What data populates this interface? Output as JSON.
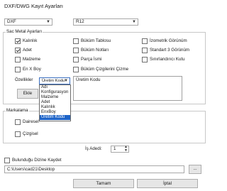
{
  "window": {
    "title": "DXF/DWG Kayıt Ayarları"
  },
  "top": {
    "format_value": "DXF",
    "version_value": "R12"
  },
  "sheet_metal": {
    "group_title": "Sac Metal Ayarları",
    "col1": [
      {
        "label": "Kalınlık",
        "checked": true
      },
      {
        "label": "Adet",
        "checked": true
      },
      {
        "label": "Malzeme",
        "checked": false
      },
      {
        "label": "En X Boy",
        "checked": false
      }
    ],
    "col2": [
      {
        "label": "Büküm Tablosu",
        "checked": false
      },
      {
        "label": "Büküm Notları",
        "checked": false
      },
      {
        "label": "Parça İsmi",
        "checked": false
      },
      {
        "label": "Büküm Çizgilerini Çizme",
        "checked": false
      }
    ],
    "col3": [
      {
        "label": "İzometrik Görünüm",
        "checked": false
      },
      {
        "label": "Standart 3 Görünüm",
        "checked": false
      },
      {
        "label": "Sınırlandırıcı Kutu",
        "checked": false
      }
    ],
    "properties_label": "Özellikler",
    "properties_selected": "Üretim Kodu",
    "add_button": "Ekle",
    "properties_list_value": "Üretim Kodu",
    "dropdown_options": [
      "Adı",
      "Konfigurasyon",
      "Malzeme",
      "Adet",
      "Kalınlık",
      "EnxBoy",
      "Üretim Kodu"
    ],
    "dropdown_selected_index": 6
  },
  "marking": {
    "group_title": "Markalama",
    "options": [
      {
        "label": "Dairesel",
        "checked": false
      },
      {
        "label": "Çizgisel",
        "checked": false
      }
    ]
  },
  "thread_count": {
    "label": "İş Adedi:",
    "value": "1"
  },
  "save_folder": {
    "label": "Bulunduğu Dizine Kaydet",
    "checked": false,
    "path": "C:\\Users\\cad21\\Desktop",
    "browse_label": "..."
  },
  "buttons": {
    "ok": "Tamam",
    "cancel": "İptal"
  }
}
